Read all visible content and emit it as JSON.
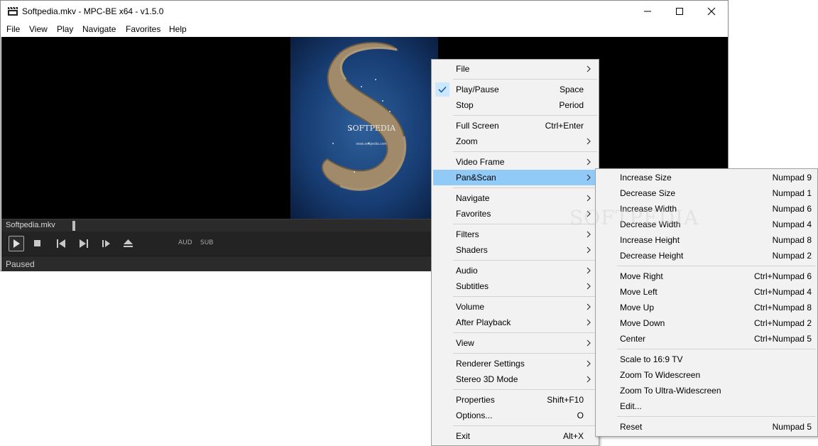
{
  "window": {
    "title": "Softpedia.mkv - MPC-BE x64 - v1.5.0"
  },
  "menubar": [
    "File",
    "View",
    "Play",
    "Navigate",
    "Favorites",
    "Help"
  ],
  "video": {
    "art_brand": "SOFTPEDIA",
    "art_url": "www.softpedia.com"
  },
  "seekbar": {
    "file_label": "Softpedia.mkv"
  },
  "controls": {
    "aud_label": "AUD",
    "sub_label": "SUB"
  },
  "status": {
    "text": "Paused"
  },
  "context_menu": {
    "items": [
      {
        "label": "File",
        "shortcut": "",
        "submenu": true
      },
      {
        "label": "Play/Pause",
        "shortcut": "Space",
        "checked": true
      },
      {
        "label": "Stop",
        "shortcut": "Period"
      },
      {
        "label": "Full Screen",
        "shortcut": "Ctrl+Enter"
      },
      {
        "label": "Zoom",
        "shortcut": "",
        "submenu": true
      },
      {
        "label": "Video Frame",
        "shortcut": "",
        "submenu": true
      },
      {
        "label": "Pan&Scan",
        "shortcut": "",
        "submenu": true,
        "highlighted": true
      },
      {
        "label": "Navigate",
        "shortcut": "",
        "submenu": true
      },
      {
        "label": "Favorites",
        "shortcut": "",
        "submenu": true
      },
      {
        "label": "Filters",
        "shortcut": "",
        "submenu": true
      },
      {
        "label": "Shaders",
        "shortcut": "",
        "submenu": true
      },
      {
        "label": "Audio",
        "shortcut": "",
        "submenu": true
      },
      {
        "label": "Subtitles",
        "shortcut": "",
        "submenu": true
      },
      {
        "label": "Volume",
        "shortcut": "",
        "submenu": true
      },
      {
        "label": "After Playback",
        "shortcut": "",
        "submenu": true
      },
      {
        "label": "View",
        "shortcut": "",
        "submenu": true
      },
      {
        "label": "Renderer Settings",
        "shortcut": "",
        "submenu": true
      },
      {
        "label": "Stereo 3D Mode",
        "shortcut": "",
        "submenu": true
      },
      {
        "label": "Properties",
        "shortcut": "Shift+F10"
      },
      {
        "label": "Options...",
        "shortcut": "O"
      },
      {
        "label": "Exit",
        "shortcut": "Alt+X"
      }
    ]
  },
  "panscan_menu": {
    "items": [
      {
        "label": "Increase Size",
        "shortcut": "Numpad 9"
      },
      {
        "label": "Decrease Size",
        "shortcut": "Numpad 1"
      },
      {
        "label": "Increase Width",
        "shortcut": "Numpad 6"
      },
      {
        "label": "Decrease Width",
        "shortcut": "Numpad 4"
      },
      {
        "label": "Increase Height",
        "shortcut": "Numpad 8"
      },
      {
        "label": "Decrease Height",
        "shortcut": "Numpad 2"
      },
      {
        "label": "Move Right",
        "shortcut": "Ctrl+Numpad 6"
      },
      {
        "label": "Move Left",
        "shortcut": "Ctrl+Numpad 4"
      },
      {
        "label": "Move Up",
        "shortcut": "Ctrl+Numpad 8"
      },
      {
        "label": "Move Down",
        "shortcut": "Ctrl+Numpad 2"
      },
      {
        "label": "Center",
        "shortcut": "Ctrl+Numpad 5"
      },
      {
        "label": "Scale to 16:9 TV",
        "shortcut": ""
      },
      {
        "label": "Zoom To Widescreen",
        "shortcut": ""
      },
      {
        "label": "Zoom To Ultra-Widescreen",
        "shortcut": ""
      },
      {
        "label": "Edit...",
        "shortcut": ""
      },
      {
        "label": "Reset",
        "shortcut": "Numpad 5"
      }
    ]
  },
  "watermark": "SOFTPEDIA",
  "colors": {
    "highlight": "#91c9f7",
    "menu_bg": "#f2f2f2",
    "player_dark": "#232323"
  }
}
